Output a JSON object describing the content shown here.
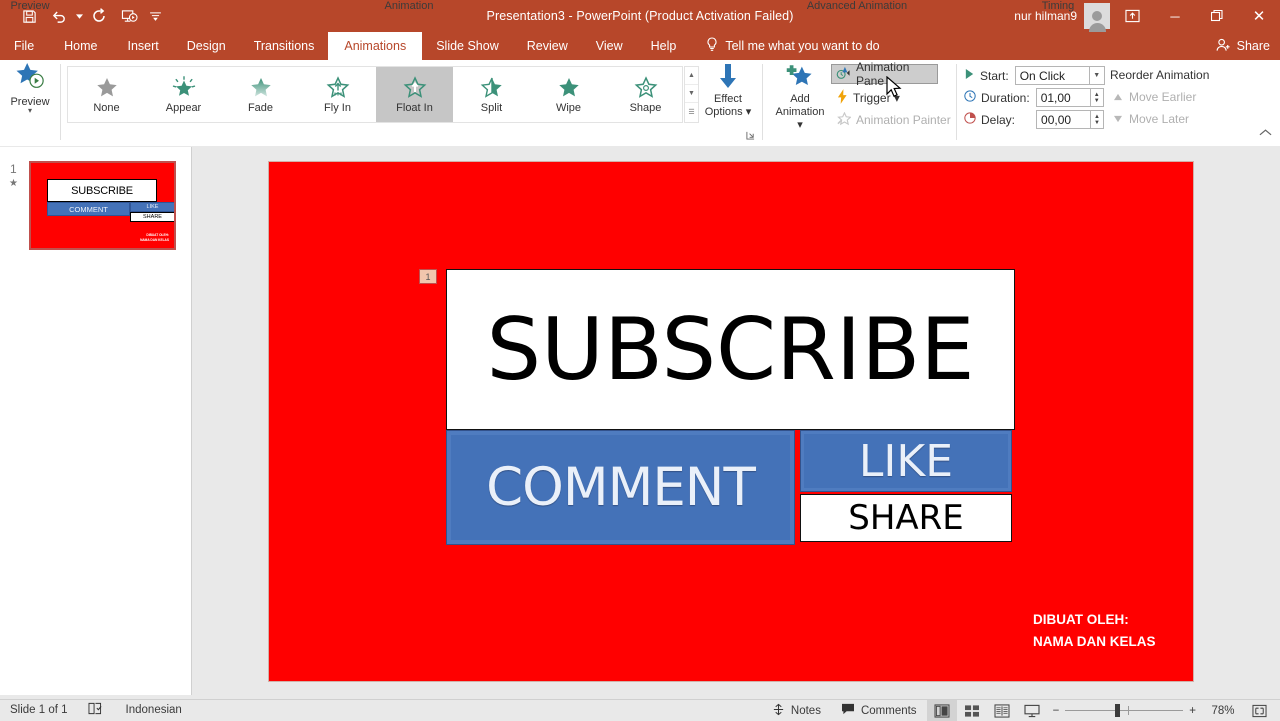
{
  "titlebar": {
    "document_title": "Presentation3  -  PowerPoint (Product Activation Failed)",
    "user_name": "nur hilman9",
    "quick_access": [
      {
        "name": "save-icon",
        "label": "Save"
      },
      {
        "name": "undo-icon",
        "label": "Undo"
      },
      {
        "name": "redo-icon",
        "label": "Redo"
      },
      {
        "name": "start-from-beginning-icon",
        "label": "Start From Beginning"
      },
      {
        "name": "customize-quick-access-icon",
        "label": "Customize Quick Access Toolbar"
      }
    ],
    "window_controls": {
      "ribbon_display_options": "Ribbon Display Options",
      "minimize": "─",
      "restore": "❐",
      "close": "✕"
    }
  },
  "tabs": {
    "items": [
      {
        "label": "File",
        "active": false
      },
      {
        "label": "Home",
        "active": false
      },
      {
        "label": "Insert",
        "active": false
      },
      {
        "label": "Design",
        "active": false
      },
      {
        "label": "Transitions",
        "active": false
      },
      {
        "label": "Animations",
        "active": true
      },
      {
        "label": "Slide Show",
        "active": false
      },
      {
        "label": "Review",
        "active": false
      },
      {
        "label": "View",
        "active": false
      },
      {
        "label": "Help",
        "active": false
      }
    ],
    "tell_me": "Tell me what you want to do",
    "share": "Share"
  },
  "ribbon": {
    "preview": {
      "button_label": "Preview",
      "group_label": "Preview"
    },
    "animation_group": {
      "group_label": "Animation",
      "items": [
        {
          "label": "None",
          "selected": false
        },
        {
          "label": "Appear",
          "selected": false
        },
        {
          "label": "Fade",
          "selected": false
        },
        {
          "label": "Fly In",
          "selected": false
        },
        {
          "label": "Float In",
          "selected": true
        },
        {
          "label": "Split",
          "selected": false
        },
        {
          "label": "Wipe",
          "selected": false
        },
        {
          "label": "Shape",
          "selected": false
        }
      ],
      "effect_options_line1": "Effect",
      "effect_options_line2": "Options"
    },
    "advanced_animation": {
      "group_label": "Advanced Animation",
      "add_animation_line1": "Add",
      "add_animation_line2": "Animation",
      "animation_pane": "Animation Pane",
      "trigger": "Trigger",
      "animation_painter": "Animation Painter"
    },
    "timing": {
      "group_label": "Timing",
      "start_label": "Start:",
      "start_value": "On Click",
      "duration_label": "Duration:",
      "duration_value": "01,00",
      "delay_label": "Delay:",
      "delay_value": "00,00",
      "reorder_title": "Reorder Animation",
      "move_earlier": "Move Earlier",
      "move_later": "Move Later"
    }
  },
  "thumbnail_pane": {
    "slide_number": "1",
    "animation_marker": "★",
    "slide_preview": {
      "subscribe": "SUBSCRIBE",
      "comment": "COMMENT",
      "like": "LIKE",
      "share": "SHARE",
      "credit_line1": "DIBUAT OLEH:",
      "credit_line2": "NAMA DAN KELAS"
    }
  },
  "slide": {
    "background_color": "#ff0000",
    "animation_badge": "1",
    "subscribe_text": "SUBSCRIBE",
    "comment_text": "COMMENT",
    "like_text": "LIKE",
    "share_text": "SHARE",
    "credit_line1": "DIBUAT OLEH:",
    "credit_line2": "NAMA DAN KELAS",
    "button_color": "#4472b8"
  },
  "statusbar": {
    "slide_count": "Slide 1 of 1",
    "language": "Indonesian",
    "notes": "Notes",
    "comments": "Comments",
    "views": [
      {
        "name": "normal-view",
        "active": true
      },
      {
        "name": "slide-sorter-view",
        "active": false
      },
      {
        "name": "reading-view",
        "active": false
      },
      {
        "name": "slide-show-view",
        "active": false
      }
    ],
    "zoom_out": "−",
    "zoom_in": "+",
    "zoom_level": "78%",
    "fit_to_window": "Fit slide to current window"
  },
  "theme": {
    "accent": "#b7472a",
    "tab_active_bg": "#ffffff",
    "slide_red": "#ff0000",
    "button_blue": "#4472b8"
  }
}
